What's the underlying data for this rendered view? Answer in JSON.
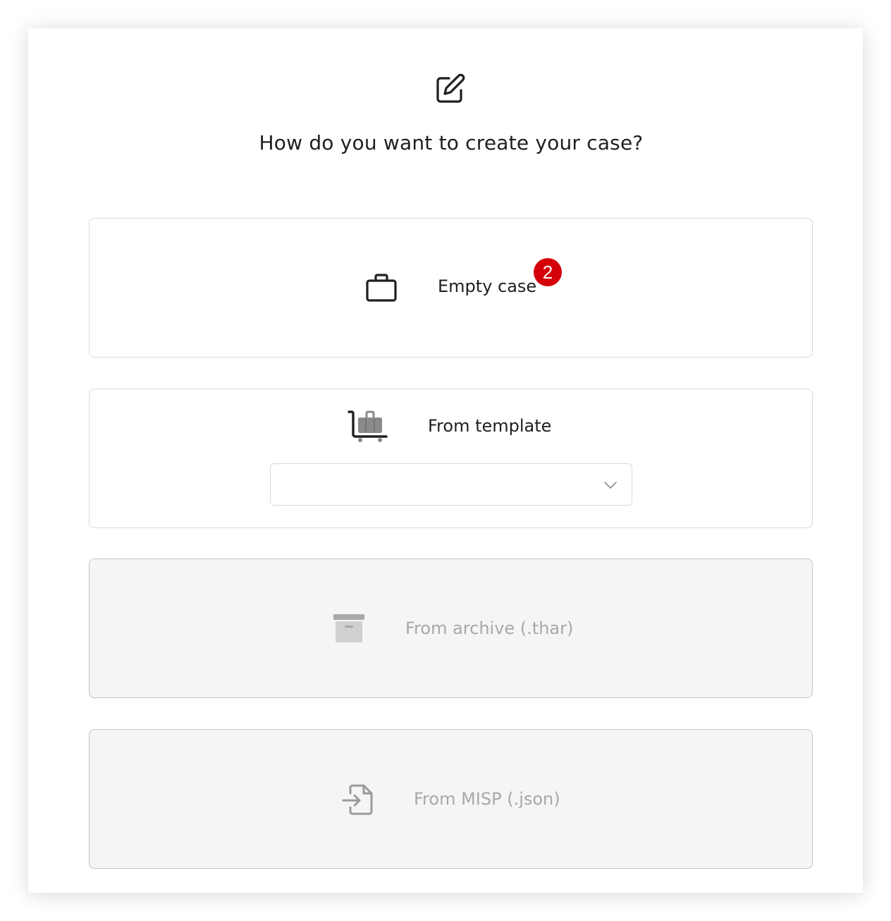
{
  "header": {
    "icon": "edit-icon",
    "question": "How do you want to create your case?"
  },
  "options": {
    "empty_case": {
      "icon": "briefcase-icon",
      "label": "Empty case",
      "badge": "2",
      "badge_color": "#d4000a"
    },
    "from_template": {
      "icon": "luggage-cart-icon",
      "label": "From template",
      "select": {
        "value": "",
        "icon": "chevron-down-icon"
      }
    },
    "from_archive": {
      "icon": "archive-box-icon",
      "label": "From archive (.thar)",
      "disabled": true
    },
    "from_misp": {
      "icon": "file-import-icon",
      "label": "From MISP (.json)",
      "disabled": true
    }
  },
  "colors": {
    "text": "#1f1f1f",
    "disabled_text": "#a8a8a8",
    "disabled_bg": "#f5f5f5",
    "border": "#d9d9d9"
  }
}
